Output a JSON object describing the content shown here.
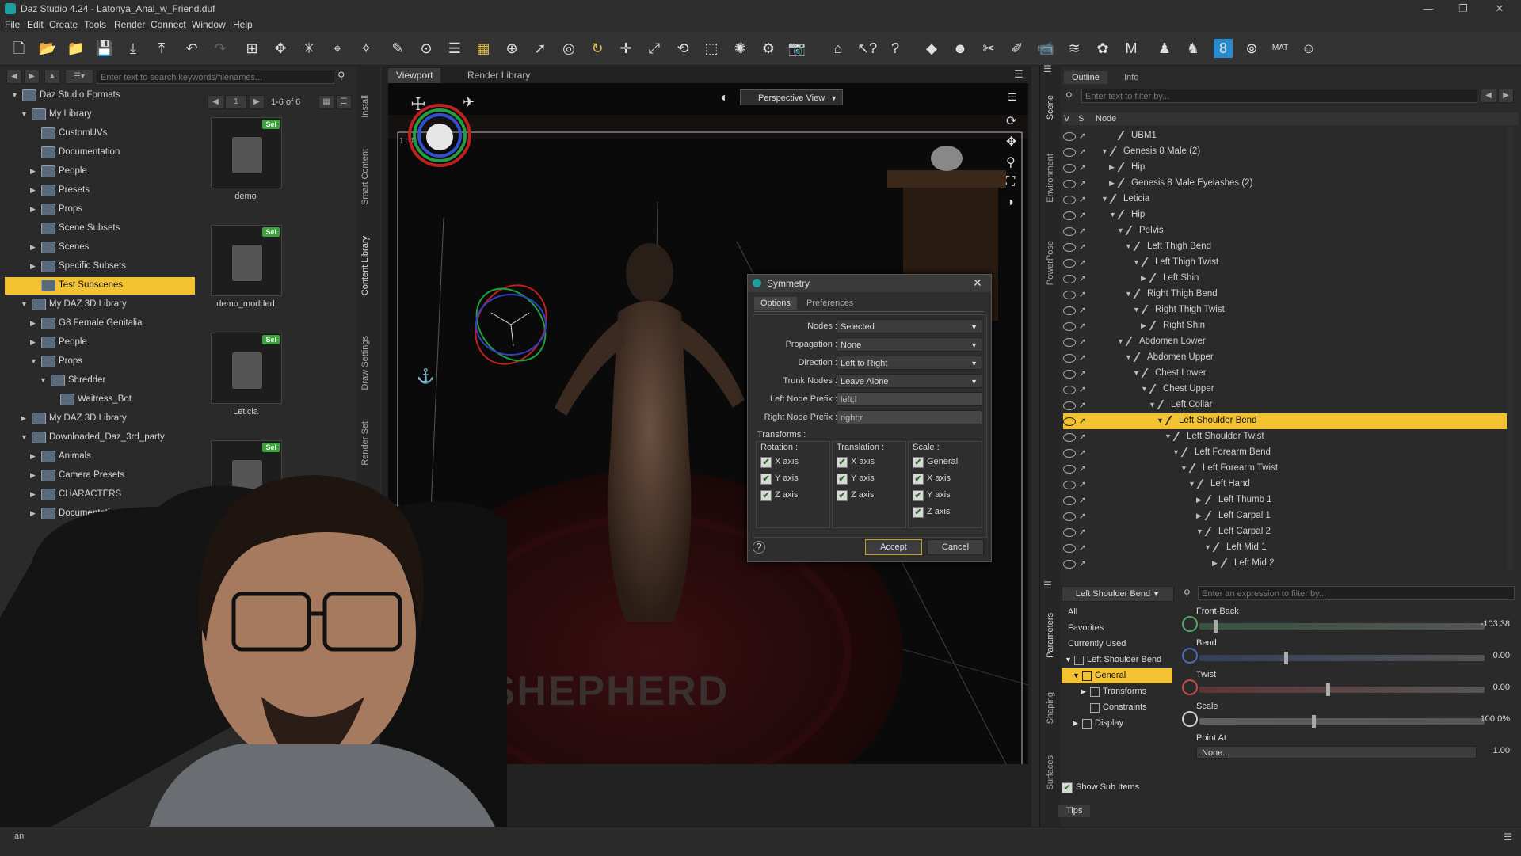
{
  "window": {
    "title": "Daz Studio 4.24 - Latonya_Anal_w_Friend.duf"
  },
  "menu": [
    "File",
    "Edit",
    "Create",
    "Tools",
    "Render",
    "Connect",
    "Window",
    "Help"
  ],
  "content_library": {
    "search_placeholder": "Enter text to search keywords/filenames...",
    "page": "1",
    "range": "1-6 of 6",
    "tree": [
      {
        "label": "Daz Studio Formats",
        "level": 0,
        "expanded": true
      },
      {
        "label": "My Library",
        "level": 1,
        "expanded": true
      },
      {
        "label": "CustomUVs",
        "level": 2
      },
      {
        "label": "Documentation",
        "level": 2
      },
      {
        "label": "People",
        "level": 2,
        "collapsed": true
      },
      {
        "label": "Presets",
        "level": 2,
        "collapsed": true
      },
      {
        "label": "Props",
        "level": 2,
        "collapsed": true
      },
      {
        "label": "Scene Subsets",
        "level": 2
      },
      {
        "label": "Scenes",
        "level": 2,
        "collapsed": true
      },
      {
        "label": "Specific Subsets",
        "level": 2,
        "collapsed": true
      },
      {
        "label": "Test Subscenes",
        "level": 2,
        "selected": true
      },
      {
        "label": "My DAZ 3D Library",
        "level": 1,
        "expanded": true
      },
      {
        "label": "G8 Female Genitalia",
        "level": 2,
        "collapsed": true
      },
      {
        "label": "People",
        "level": 2,
        "collapsed": true
      },
      {
        "label": "Props",
        "level": 2,
        "expanded": true
      },
      {
        "label": "Shredder",
        "level": 3,
        "expanded": true
      },
      {
        "label": "Waitress_Bot",
        "level": 4
      },
      {
        "label": "My DAZ 3D Library",
        "level": 1,
        "collapsed": true
      },
      {
        "label": "Downloaded_Daz_3rd_party",
        "level": 1,
        "expanded": true
      },
      {
        "label": "Animals",
        "level": 2,
        "collapsed": true
      },
      {
        "label": "Camera Presets",
        "level": 2,
        "collapsed": true
      },
      {
        "label": "CHARACTERS",
        "level": 2,
        "collapsed": true
      },
      {
        "label": "Documentation",
        "level": 2,
        "collapsed": true
      }
    ],
    "tiles": [
      {
        "label": "demo",
        "badge": "Sel"
      },
      {
        "label": "demo_modded",
        "badge": "Sel"
      },
      {
        "label": "Leticia",
        "badge": "Sel"
      },
      {
        "label": "",
        "badge": "Sel"
      }
    ],
    "side_tabs": [
      "Install",
      "Smart Content",
      "Content Library",
      "Draw Settings",
      "Render Set"
    ],
    "status": "an"
  },
  "viewport": {
    "tabs": [
      "Viewport",
      "Render Library"
    ],
    "view_dropdown": "Perspective View",
    "scale_label": "1 : 1",
    "floor_text": "RR SHEPHERD"
  },
  "symmetry_dialog": {
    "title": "Symmetry",
    "tabs": [
      "Options",
      "Preferences"
    ],
    "fields": [
      {
        "key": "Nodes :",
        "value": "Selected",
        "type": "dropdown"
      },
      {
        "key": "Propagation :",
        "value": "None",
        "type": "dropdown"
      },
      {
        "key": "Direction :",
        "value": "Left to Right",
        "type": "dropdown"
      },
      {
        "key": "Trunk Nodes :",
        "value": "Leave Alone",
        "type": "dropdown"
      },
      {
        "key": "Left Node Prefix :",
        "value": "left;l",
        "type": "text"
      },
      {
        "key": "Right Node Prefix :",
        "value": "right;r",
        "type": "text"
      }
    ],
    "transforms_label": "Transforms :",
    "groups": [
      {
        "title": "Rotation :",
        "items": [
          "X axis",
          "Y axis",
          "Z axis"
        ]
      },
      {
        "title": "Translation :",
        "items": [
          "X axis",
          "Y axis",
          "Z axis"
        ]
      },
      {
        "title": "Scale :",
        "items": [
          "General",
          "X axis",
          "Y axis",
          "Z axis"
        ]
      }
    ],
    "accept": "Accept",
    "cancel": "Cancel"
  },
  "scene": {
    "tabs": [
      "Outline",
      "Info"
    ],
    "filter_placeholder": "Enter text to filter by...",
    "columns": [
      "V",
      "S",
      "Node"
    ],
    "side_tabs": [
      "Scene",
      "Environment",
      "PowerPose"
    ],
    "rows": [
      {
        "label": "UBM1",
        "indent": 2
      },
      {
        "label": "Genesis 8 Male (2)",
        "indent": 1,
        "arrow": "down"
      },
      {
        "label": "Hip",
        "indent": 2,
        "arrow": "right"
      },
      {
        "label": "Genesis 8 Male Eyelashes (2)",
        "indent": 2,
        "arrow": "right"
      },
      {
        "label": "Leticia",
        "indent": 1,
        "arrow": "down"
      },
      {
        "label": "Hip",
        "indent": 2,
        "arrow": "down"
      },
      {
        "label": "Pelvis",
        "indent": 3,
        "arrow": "down"
      },
      {
        "label": "Left Thigh Bend",
        "indent": 4,
        "arrow": "down"
      },
      {
        "label": "Left Thigh Twist",
        "indent": 5,
        "arrow": "down"
      },
      {
        "label": "Left Shin",
        "indent": 6,
        "arrow": "right"
      },
      {
        "label": "Right Thigh Bend",
        "indent": 4,
        "arrow": "down"
      },
      {
        "label": "Right Thigh Twist",
        "indent": 5,
        "arrow": "down"
      },
      {
        "label": "Right Shin",
        "indent": 6,
        "arrow": "right"
      },
      {
        "label": "Abdomen Lower",
        "indent": 3,
        "arrow": "down"
      },
      {
        "label": "Abdomen Upper",
        "indent": 4,
        "arrow": "down"
      },
      {
        "label": "Chest Lower",
        "indent": 5,
        "arrow": "down"
      },
      {
        "label": "Chest Upper",
        "indent": 6,
        "arrow": "down"
      },
      {
        "label": "Left Collar",
        "indent": 7,
        "arrow": "down"
      },
      {
        "label": "Left Shoulder Bend",
        "indent": 8,
        "arrow": "down",
        "selected": true
      },
      {
        "label": "Left Shoulder Twist",
        "indent": 9,
        "arrow": "down"
      },
      {
        "label": "Left Forearm Bend",
        "indent": 10,
        "arrow": "down"
      },
      {
        "label": "Left Forearm Twist",
        "indent": 11,
        "arrow": "down"
      },
      {
        "label": "Left Hand",
        "indent": 12,
        "arrow": "down"
      },
      {
        "label": "Left Thumb 1",
        "indent": 13,
        "arrow": "right"
      },
      {
        "label": "Left Carpal 1",
        "indent": 13,
        "arrow": "right"
      },
      {
        "label": "Left Carpal 2",
        "indent": 13,
        "arrow": "down"
      },
      {
        "label": "Left Mid 1",
        "indent": 14,
        "arrow": "down"
      },
      {
        "label": "Left Mid 2",
        "indent": 15,
        "arrow": "right"
      }
    ]
  },
  "parameters": {
    "node_dropdown": "Left Shoulder Bend",
    "filter_placeholder": "Enter an expression to filter by...",
    "side_tabs": [
      "Parameters",
      "Shaping",
      "Surfaces"
    ],
    "categories": [
      {
        "label": "All"
      },
      {
        "label": "Favorites"
      },
      {
        "label": "Currently Used"
      },
      {
        "label": "Left Shoulder Bend",
        "tree": true,
        "level": 0
      },
      {
        "label": "General",
        "tree": true,
        "level": 1,
        "selected": true
      },
      {
        "label": "Transforms",
        "tree": true,
        "level": 2
      },
      {
        "label": "Constraints",
        "tree": true,
        "level": 2
      },
      {
        "label": "Display",
        "tree": true,
        "level": 1
      }
    ],
    "show_sub_items": "Show Sub Items",
    "tips": "Tips",
    "params": [
      {
        "name": "Front-Back",
        "value": "-103.38",
        "level": 0.05,
        "color": "#4fa86a"
      },
      {
        "name": "Bend",
        "value": "0.00",
        "level": 0.3,
        "color": "#4a6ab8"
      },
      {
        "name": "Twist",
        "value": "0.00",
        "level": 0.45,
        "color": "#c84a4a"
      },
      {
        "name": "Scale",
        "value": "100.0%",
        "level": 0.4,
        "color": "#cccccc"
      }
    ],
    "point_at": {
      "name": "Point At",
      "value": "None...",
      "number": "1.00"
    }
  },
  "colors": {
    "accent": "#f2c230",
    "selection_text": "#111111",
    "check": "#3ea33e"
  }
}
